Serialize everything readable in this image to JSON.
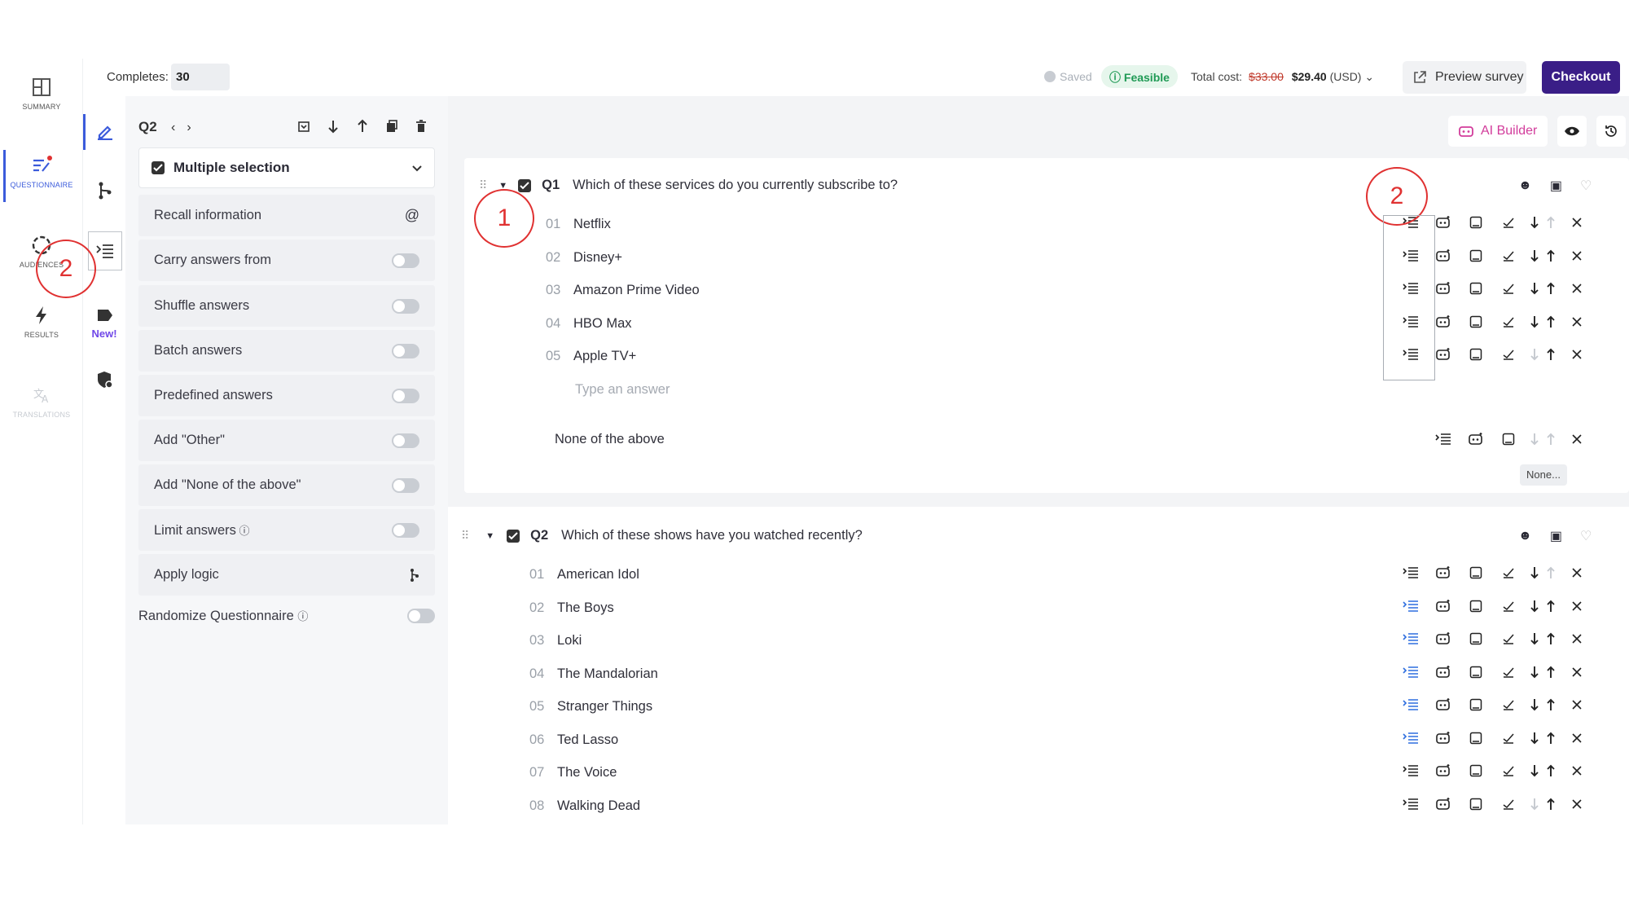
{
  "topbar": {
    "completes_label": "Completes:",
    "completes_value": "30",
    "saved": "Saved",
    "feasible": "Feasible",
    "total_cost_label": "Total cost:",
    "old_cost": "$33.00",
    "new_cost": "$29.40",
    "currency": "(USD)",
    "preview_label": "Preview survey",
    "checkout_label": "Checkout"
  },
  "rail": {
    "summary": "SUMMARY",
    "questionnaire": "QUESTIONNAIRE",
    "audiences": "AUDIENCES",
    "results": "RESULTS",
    "translations": "TRANSLATIONS"
  },
  "iconcol": {
    "new_badge": "New!"
  },
  "panel": {
    "question": "Q2",
    "type": "Multiple selection",
    "recall": "Recall information",
    "recall_symbol": "@",
    "options": [
      {
        "label": "Carry answers from"
      },
      {
        "label": "Shuffle answers"
      },
      {
        "label": "Batch answers"
      },
      {
        "label": "Predefined answers"
      },
      {
        "label": "Add \"Other\""
      },
      {
        "label": "Add \"None of the above\""
      },
      {
        "label": "Limit answers"
      }
    ],
    "apply_logic": "Apply logic",
    "randomize": "Randomize Questionnaire"
  },
  "main": {
    "ai_builder": "AI Builder"
  },
  "q1": {
    "num": "Q1",
    "title": "Which of these services do you currently subscribe to?",
    "answers": [
      {
        "n": "01",
        "t": "Netflix"
      },
      {
        "n": "02",
        "t": "Disney+"
      },
      {
        "n": "03",
        "t": "Amazon Prime Video"
      },
      {
        "n": "04",
        "t": "HBO Max"
      },
      {
        "n": "05",
        "t": "Apple TV+"
      }
    ],
    "placeholder": "Type an answer",
    "none_label": "None of the above",
    "none_tag": "None..."
  },
  "q2": {
    "num": "Q2",
    "title": "Which of these shows have you watched recently?",
    "answers": [
      {
        "n": "01",
        "t": "American Idol"
      },
      {
        "n": "02",
        "t": "The Boys"
      },
      {
        "n": "03",
        "t": "Loki"
      },
      {
        "n": "04",
        "t": "The Mandalorian"
      },
      {
        "n": "05",
        "t": "Stranger Things"
      },
      {
        "n": "06",
        "t": "Ted Lasso"
      },
      {
        "n": "07",
        "t": "The Voice"
      },
      {
        "n": "08",
        "t": "Walking Dead"
      }
    ]
  },
  "annotations": {
    "one": "1",
    "two": "2"
  },
  "colors": {
    "accent": "#3a1e87",
    "ai": "#d23c9b",
    "feasible": "#1f9a55",
    "annotation": "#e03131",
    "logic_active": "#2f6fdf"
  }
}
